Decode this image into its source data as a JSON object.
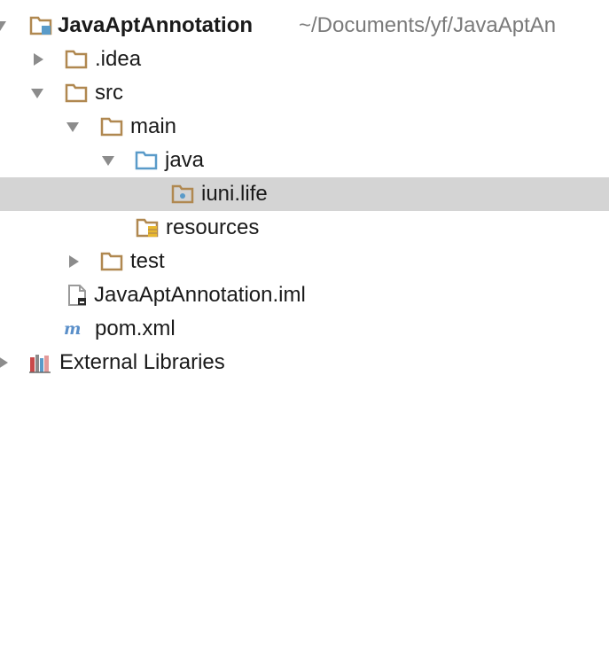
{
  "tree": {
    "project": {
      "name": "JavaAptAnnotation",
      "path": "~/Documents/yf/JavaAptAn",
      "icon": "project-folder-icon",
      "expanded": true
    },
    "idea": {
      "name": ".idea",
      "icon": "folder-icon",
      "expanded": false
    },
    "src": {
      "name": "src",
      "icon": "folder-icon",
      "expanded": true
    },
    "main": {
      "name": "main",
      "icon": "folder-icon",
      "expanded": true
    },
    "java": {
      "name": "java",
      "icon": "source-root-folder-icon",
      "color": "#5a9bc9",
      "expanded": true
    },
    "package": {
      "name": "iuni.life",
      "icon": "package-icon",
      "selected": true
    },
    "resources": {
      "name": "resources",
      "icon": "resources-folder-icon"
    },
    "test": {
      "name": "test",
      "icon": "folder-icon",
      "expanded": false
    },
    "iml": {
      "name": "JavaAptAnnotation.iml",
      "icon": "iml-file-icon"
    },
    "pom": {
      "name": "pom.xml",
      "icon": "maven-icon"
    },
    "libraries": {
      "name": "External Libraries",
      "icon": "libraries-icon",
      "expanded": false
    }
  },
  "colors": {
    "folder": "#b08850",
    "source_root": "#5a9bc9",
    "selection": "#d4d4d4",
    "arrow": "#8c8c8c",
    "path_text": "#7a7a7a"
  }
}
